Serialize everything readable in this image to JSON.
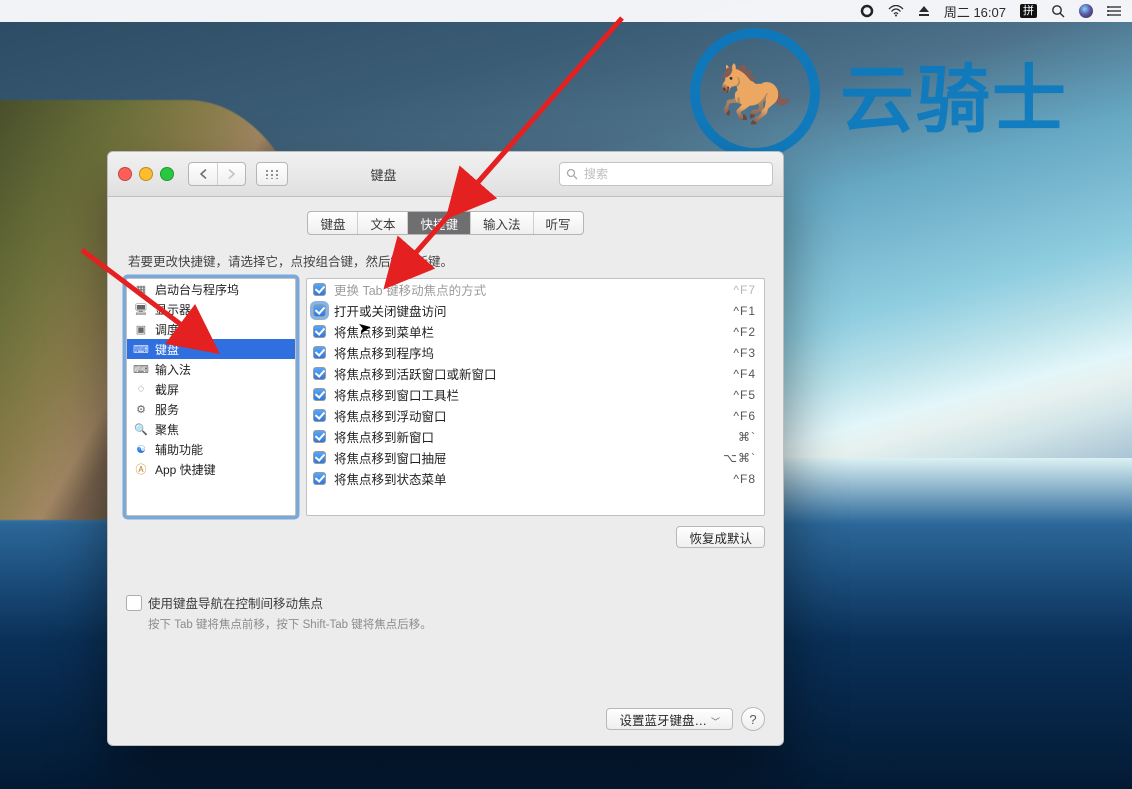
{
  "menubar": {
    "day_time": "周二 16:07",
    "ime": "拼"
  },
  "watermark": {
    "text": "云骑士"
  },
  "window": {
    "title": "键盘",
    "search_placeholder": "搜索"
  },
  "tabs": {
    "items": [
      {
        "label": "键盘"
      },
      {
        "label": "文本"
      },
      {
        "label": "快捷键"
      },
      {
        "label": "输入法"
      },
      {
        "label": "听写"
      }
    ],
    "selected_index": 2
  },
  "hint": "若要更改快捷键，请选择它，点按组合键，然后键入新键。",
  "sidebar": {
    "items": [
      {
        "label": "启动台与程序坞",
        "icon": "launchpad"
      },
      {
        "label": "显示器",
        "icon": "display"
      },
      {
        "label": "调度中心",
        "icon": "mission"
      },
      {
        "label": "键盘",
        "icon": "keyboard"
      },
      {
        "label": "输入法",
        "icon": "input"
      },
      {
        "label": "截屏",
        "icon": "screenshot"
      },
      {
        "label": "服务",
        "icon": "services"
      },
      {
        "label": "聚焦",
        "icon": "spotlight"
      },
      {
        "label": "辅助功能",
        "icon": "accessibility"
      },
      {
        "label": "App 快捷键",
        "icon": "app"
      }
    ],
    "selected_index": 3
  },
  "shortcuts": {
    "items": [
      {
        "desc": "更换 Tab 键移动焦点的方式",
        "keys": "^F7",
        "checked": true,
        "dimmed": true
      },
      {
        "desc": "打开或关闭键盘访问",
        "keys": "^F1",
        "checked": true,
        "highlight": true
      },
      {
        "desc": "将焦点移到菜单栏",
        "keys": "^F2",
        "checked": true
      },
      {
        "desc": "将焦点移到程序坞",
        "keys": "^F3",
        "checked": true
      },
      {
        "desc": "将焦点移到活跃窗口或新窗口",
        "keys": "^F4",
        "checked": true
      },
      {
        "desc": "将焦点移到窗口工具栏",
        "keys": "^F5",
        "checked": true
      },
      {
        "desc": "将焦点移到浮动窗口",
        "keys": "^F6",
        "checked": true
      },
      {
        "desc": "将焦点移到新窗口",
        "keys": "⌘`",
        "checked": true
      },
      {
        "desc": "将焦点移到窗口抽屉",
        "keys": "⌥⌘`",
        "checked": true
      },
      {
        "desc": "将焦点移到状态菜单",
        "keys": "^F8",
        "checked": true
      }
    ]
  },
  "buttons": {
    "restore": "恢复成默认",
    "bluetooth": "设置蓝牙键盘…"
  },
  "lower": {
    "checkbox_label": "使用键盘导航在控制间移动焦点",
    "help": "按下 Tab 键将焦点前移，按下 Shift-Tab 键将焦点后移。"
  }
}
